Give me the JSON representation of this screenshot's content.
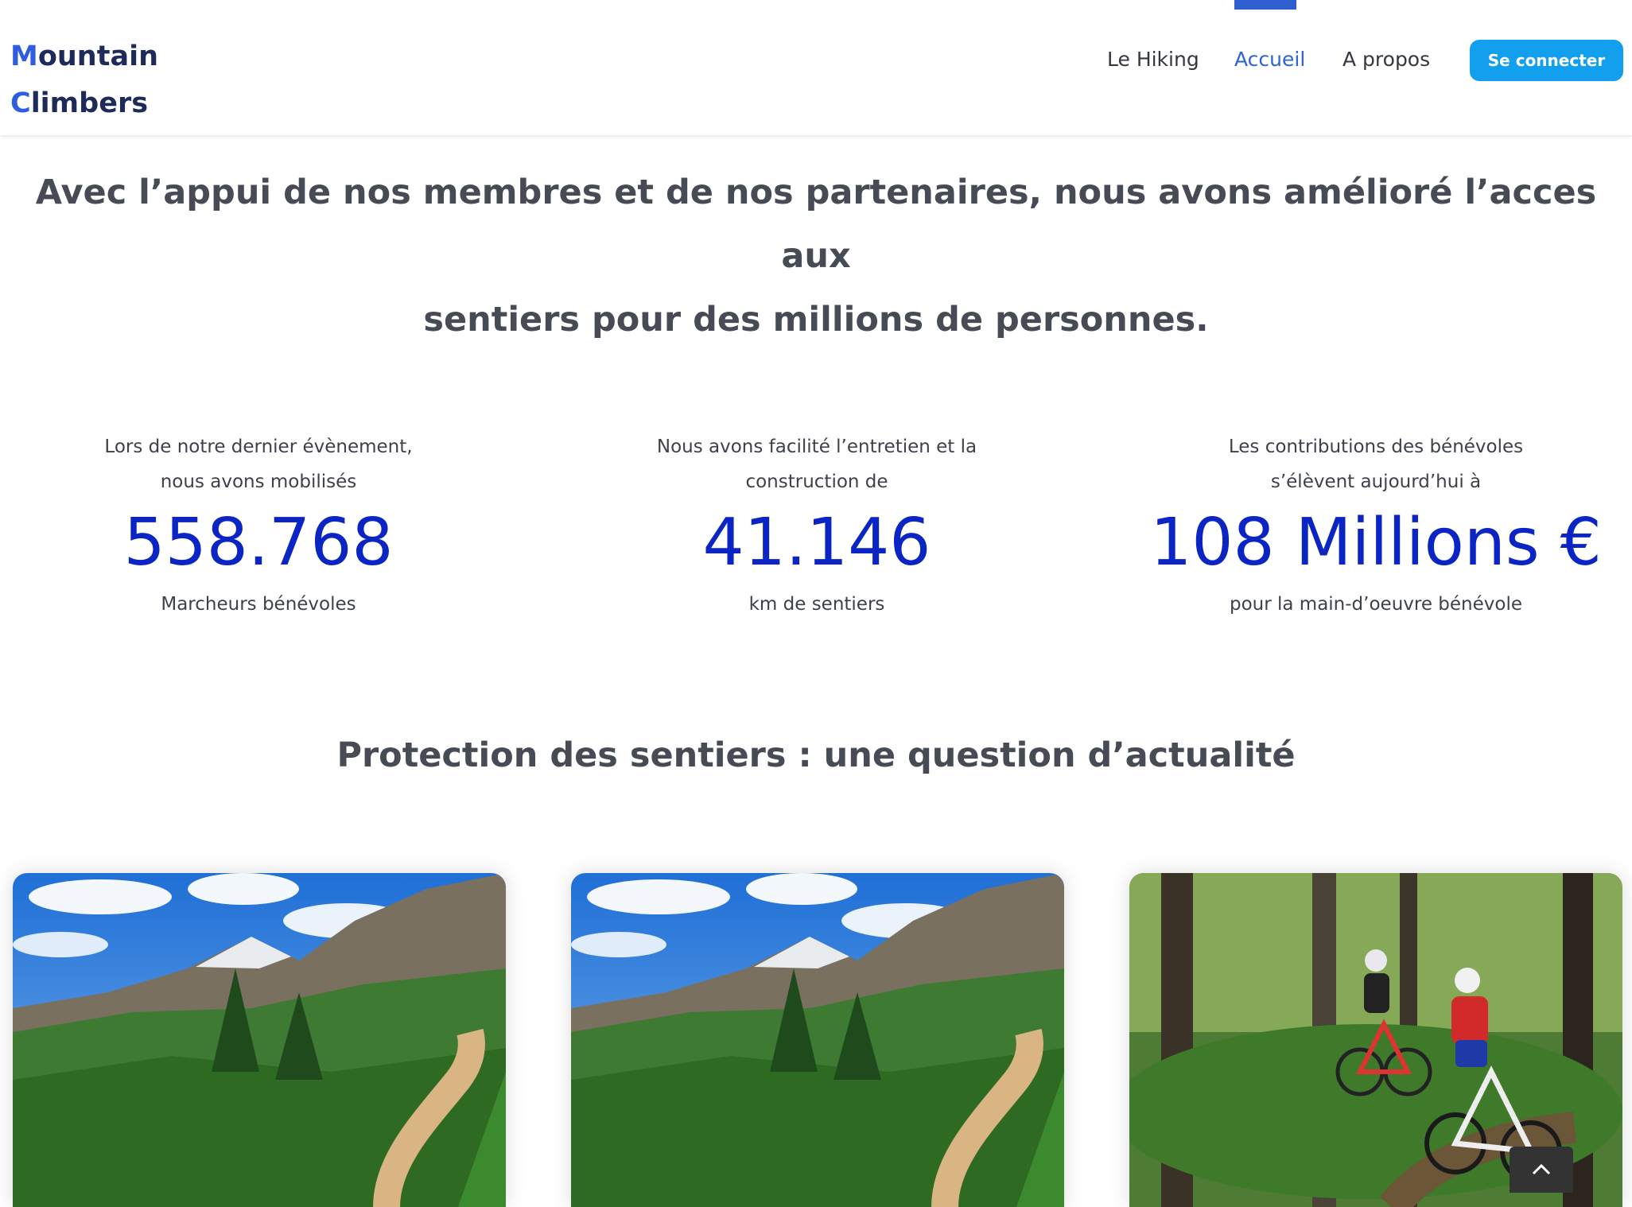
{
  "logo": {
    "line1_cap": "M",
    "line1_rest": "ountain",
    "line2_cap": "C",
    "line2_rest": "limbers"
  },
  "nav": {
    "items": [
      {
        "label": "Le Hiking"
      },
      {
        "label": "Accueil"
      },
      {
        "label": "A propos"
      }
    ],
    "active": "Accueil",
    "login_label": "Se connecter"
  },
  "intro": {
    "line1": "Avec l’appui de nos membres et de nos partenaires, nous avons amélioré  l’acces  aux",
    "line2": "sentiers pour des millions de personnes."
  },
  "stats": [
    {
      "pre": "Lors de notre dernier évènement, nous avons mobilisés",
      "value": "558.768",
      "post": "Marcheurs bénévoles"
    },
    {
      "pre": "Nous avons facilité l’entretien et la construction de",
      "value": "41.146",
      "post": "km de sentiers"
    },
    {
      "pre": "Les contributions des bénévoles s’élèvent aujourd’hui à",
      "value": "108 Millions €",
      "post": "pour la main-d’oeuvre bénévole"
    }
  ],
  "section": {
    "title": "Protection des sentiers : une question d’actualité"
  },
  "cards": [
    {
      "image": "mountain-trail-photo"
    },
    {
      "image": "mountain-trail-photo"
    },
    {
      "image": "mountain-bikers-forest-photo"
    }
  ],
  "colors": {
    "accent": "#2e63d6",
    "button": "#12a0ee",
    "stat": "#0b25c4",
    "text": "#464b55"
  },
  "icons": {
    "scroll_top": "chevron-up-icon"
  }
}
